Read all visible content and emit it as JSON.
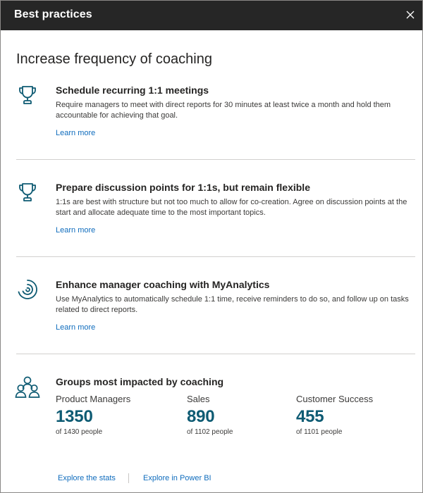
{
  "window": {
    "title": "Best practices",
    "close_icon": "close-icon"
  },
  "main": {
    "heading": "Increase frequency of coaching",
    "items": [
      {
        "icon": "trophy-icon",
        "title": "Schedule recurring 1:1 meetings",
        "description": "Require managers to meet with direct reports for 30 minutes at least twice a month and hold them accountable for achieving that goal.",
        "link": "Learn more"
      },
      {
        "icon": "trophy-icon",
        "title": "Prepare discussion points for 1:1s, but remain flexible",
        "description": "1:1s are best with structure but not too much to allow for co-creation. Agree on discussion points at the start and allocate adequate time to the most important topics.",
        "link": "Learn more"
      },
      {
        "icon": "myanalytics-icon",
        "title": "Enhance manager coaching with MyAnalytics",
        "description": "Use MyAnalytics to automatically schedule 1:1 time, receive reminders to do so, and follow up on tasks related to direct reports.",
        "link": "Learn more"
      }
    ],
    "groups": {
      "icon": "people-group-icon",
      "title": "Groups most impacted by coaching",
      "stats": [
        {
          "label": "Product Managers",
          "value": "1350",
          "sub": "of 1430 people"
        },
        {
          "label": "Sales",
          "value": "890",
          "sub": "of 1102 people"
        },
        {
          "label": "Customer Success",
          "value": "455",
          "sub": "of 1101 people"
        }
      ]
    }
  },
  "footer": {
    "explore_stats": "Explore the stats",
    "explore_powerbi": "Explore in Power BI"
  },
  "colors": {
    "titlebar_bg": "#262626",
    "accent_link": "#0f6cbd",
    "stat_value": "#0e5b73",
    "icon": "#0e5b73"
  }
}
